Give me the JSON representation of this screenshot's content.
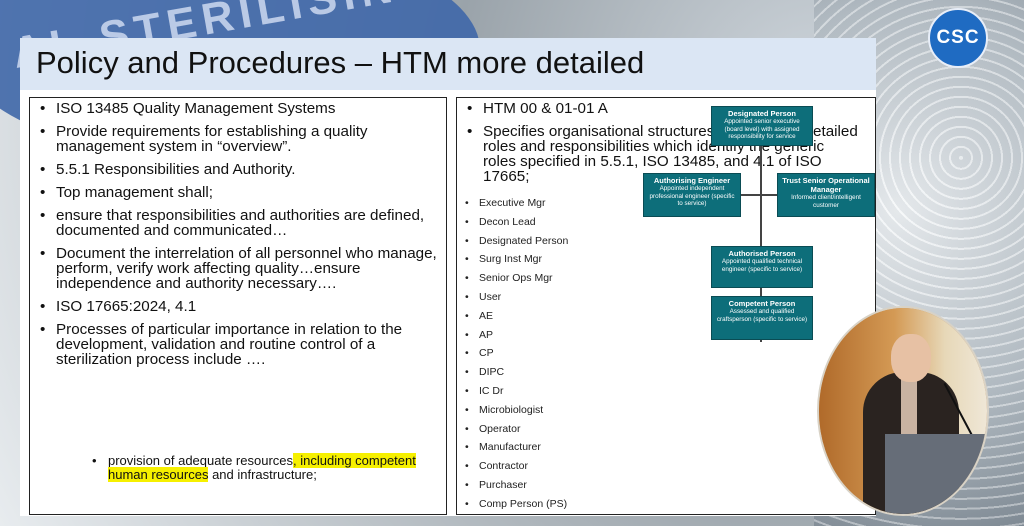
{
  "slide": {
    "title": "Policy and Procedures – HTM more detailed"
  },
  "left_box": {
    "bullets": [
      "ISO 13485 Quality Management Systems",
      "Provide requirements for establishing a quality management system in “overview”.",
      "5.5.1 Responsibilities and Authority.",
      "Top management shall;",
      " ensure that responsibilities and authorities are defined, documented and communicated…",
      "Document the interrelation of all personnel who manage, perform, verify work affecting quality…ensure independence and authority necessary….",
      "ISO 17665:2024, 4.1",
      "Processes of particular importance in relation to the development, validation and routine control of a sterilization process include …."
    ],
    "sub_bullet": {
      "before": "provision of adequate resources",
      "highlight": ", including competent human resources",
      "after": " and infrastructure;"
    }
  },
  "right_box": {
    "bullets": [
      "HTM 00 & 01-01 A",
      "Specifies organisational structures with specific detailed roles and responsibilities which identify the generic roles specified in 5.5.1, ISO 13485, and 4.1 of ISO 17665;"
    ],
    "roles": [
      "Executive Mgr",
      "Decon Lead",
      "Designated Person",
      "Surg Inst Mgr",
      "Senior Ops Mgr",
      "User",
      "AE",
      "AP",
      "CP",
      "DIPC",
      "IC Dr",
      "Microbiologist",
      "Operator",
      "Manufacturer",
      "Contractor",
      "Purchaser",
      "Comp Person (PS)"
    ]
  },
  "org_chart": {
    "designated": {
      "title": "Designated Person",
      "desc": "Appointed senior executive (board level) with assigned responsibility for service"
    },
    "authorising": {
      "title": "Authorising Engineer",
      "desc": "Appointed independent professional engineer (specific to service)"
    },
    "trust": {
      "title": "Trust Senior Operational Manager",
      "desc": "Informed client/intelligent customer"
    },
    "authorised": {
      "title": "Authorised Person",
      "desc": "Appointed qualified technical engineer (specific to service)"
    },
    "competent": {
      "title": "Competent Person",
      "desc": "Assessed and qualified craftsperson (specific to service)"
    }
  },
  "logo": {
    "text": "CSC"
  },
  "colors": {
    "title_bar": "#dbe6f4",
    "org_box": "#0d6e7a",
    "highlight": "#f6f000",
    "logo": "#1f6bc2"
  }
}
